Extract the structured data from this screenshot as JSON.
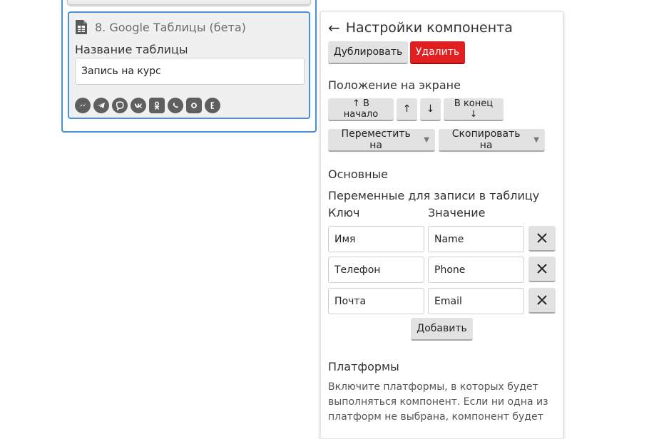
{
  "canvas": {
    "component": {
      "title": "8. Google Таблицы (бета)",
      "icon": "spreadsheet-file-icon",
      "table_name_label": "Название таблицы",
      "table_name_value": "Запись на курс",
      "platform_icons": [
        "messenger-icon",
        "telegram-icon",
        "viber-icon",
        "vk-icon",
        "odnoklassniki-icon",
        "whatsapp-icon",
        "instagram-icon",
        "yandex-icon"
      ]
    }
  },
  "panel": {
    "title": "Настройки компонента",
    "back_icon": "arrow-left-icon",
    "duplicate_label": "Дублировать",
    "delete_label": "Удалить",
    "position_title": "Положение на экране",
    "to_start_label": "↑ В начало",
    "up_label": "↑",
    "down_label": "↓",
    "to_end_label": "В конец ↓",
    "move_to_label": "Переместить на",
    "copy_to_label": "Скопировать на",
    "basic_title": "Основные",
    "variables_title": "Переменные для записи в таблицу",
    "key_header": "Ключ",
    "value_header": "Значение",
    "variables": [
      {
        "key": "Имя",
        "value": "Name"
      },
      {
        "key": "Телефон",
        "value": "Phone"
      },
      {
        "key": "Почта",
        "value": "Email"
      }
    ],
    "add_label": "Добавить",
    "platforms_title": "Платформы",
    "platforms_desc": "Включите платформы, в которых будет выполняться компонент. Если ни одна из платформ не выбрана, компонент будет"
  },
  "colors": {
    "accent": "#4a90d9",
    "danger": "#e02020",
    "button_bg": "#e2e2e2",
    "icon_gray": "#5f5f5f"
  }
}
